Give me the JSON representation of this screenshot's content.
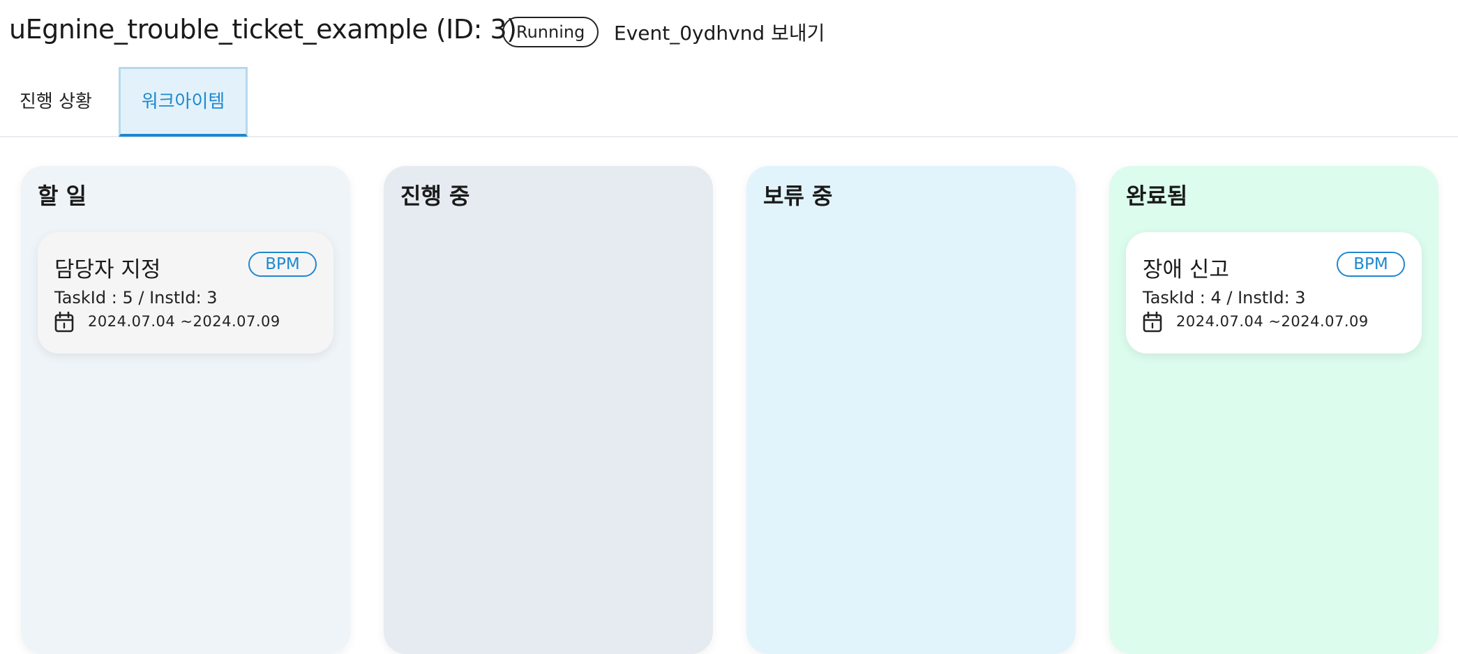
{
  "header": {
    "title": "uEgnine_trouble_ticket_example (ID: 3)",
    "status": "Running",
    "event_action": "Event_0ydhvnd 보내기"
  },
  "tabs": [
    {
      "label": "진행 상황",
      "active": false
    },
    {
      "label": "워크아이템",
      "active": true
    }
  ],
  "columns": [
    {
      "title": "할 일",
      "color": "#eff4f8",
      "cards": [
        {
          "title": "담당자 지정",
          "tag": "BPM",
          "ids": "TaskId : 5 / InstId: 3",
          "date_range": "2024.07.04 ~2024.07.09",
          "icon": "calendar-icon"
        }
      ]
    },
    {
      "title": "진행 중",
      "color": "#e5ebf0",
      "cards": []
    },
    {
      "title": "보류 중",
      "color": "#e2f4fb",
      "cards": []
    },
    {
      "title": "완료됨",
      "color": "#dcfcee",
      "cards": [
        {
          "title": "장애 신고",
          "tag": "BPM",
          "ids": "TaskId : 4 / InstId: 3",
          "date_range": "2024.07.04 ~2024.07.09",
          "icon": "calendar-icon"
        }
      ]
    }
  ],
  "colors": {
    "accent": "#1e88d0",
    "status_border": "#222222"
  }
}
